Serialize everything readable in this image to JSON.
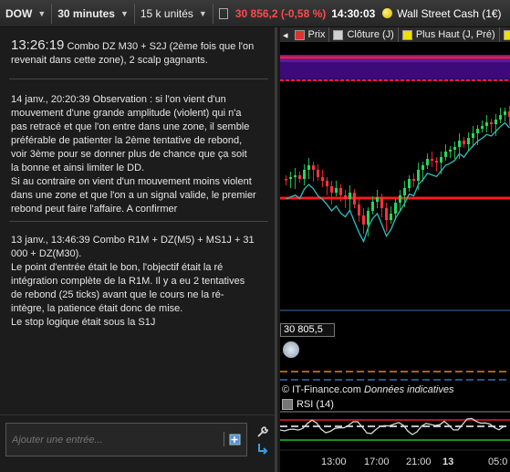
{
  "toolbar": {
    "instrument": "DOW",
    "timeframe": "30 minutes",
    "units": "15 k unités",
    "price": "30 856,2 (-0,58 %)",
    "time": "14:30:03",
    "market_name": "Wall Street Cash (1€)"
  },
  "journal": {
    "entries": [
      {
        "time": "13:26:19",
        "text": " Combo DZ M30 + S2J (2ème fois que l'on revenait dans cette zone), 2 scalp gagnants."
      },
      {
        "header": "14 janv., 20:20:39 Observation : si l'on vient d'un mouvement d'une grande amplitude (violent) qui n'a pas retracé et que l'on entre dans une zone, il semble préférable de patienter la 2ème tentative de rebond, voir 3ème pour se donner plus de chance que ça soit la bonne et ainsi limiter le DD.",
        "text": "Si au contraire on vient d'un mouvement moins violent dans une zone et que l'on a un signal valide, le premier rebond peut faire l'affaire. A confirmer"
      },
      {
        "header": "13 janv., 13:46:39 Combo R1M + DZ(M5) + MS1J + 31 000 + DZ(M30).",
        "line1": " Le point d'entrée était le bon, l'objectif était la ré intégration complète de la R1M. Il y a eu 2 tentatives de rebond (25 ticks) avant que le cours ne la ré- intègre, la patience était donc de mise.",
        "line2": "Le stop logique était sous la S1J"
      }
    ],
    "input_placeholder": "Ajouter une entrée..."
  },
  "legend": {
    "items": [
      {
        "label": "Prix",
        "color": "#e03030"
      },
      {
        "label": "Clôture (J)",
        "color": "#d0d0d0"
      },
      {
        "label": "Plus Haut (J, Pré)",
        "color": "#f0e000"
      },
      {
        "label": "",
        "color": "#f0e000"
      }
    ]
  },
  "chart": {
    "price_label": "30 805,5",
    "credit": "© IT-Finance.com",
    "credit_note": "Données indicatives",
    "rsi_label": "RSI (14)",
    "x_ticks": [
      "13:00",
      "17:00",
      "21:00",
      "13",
      "05:0"
    ]
  }
}
